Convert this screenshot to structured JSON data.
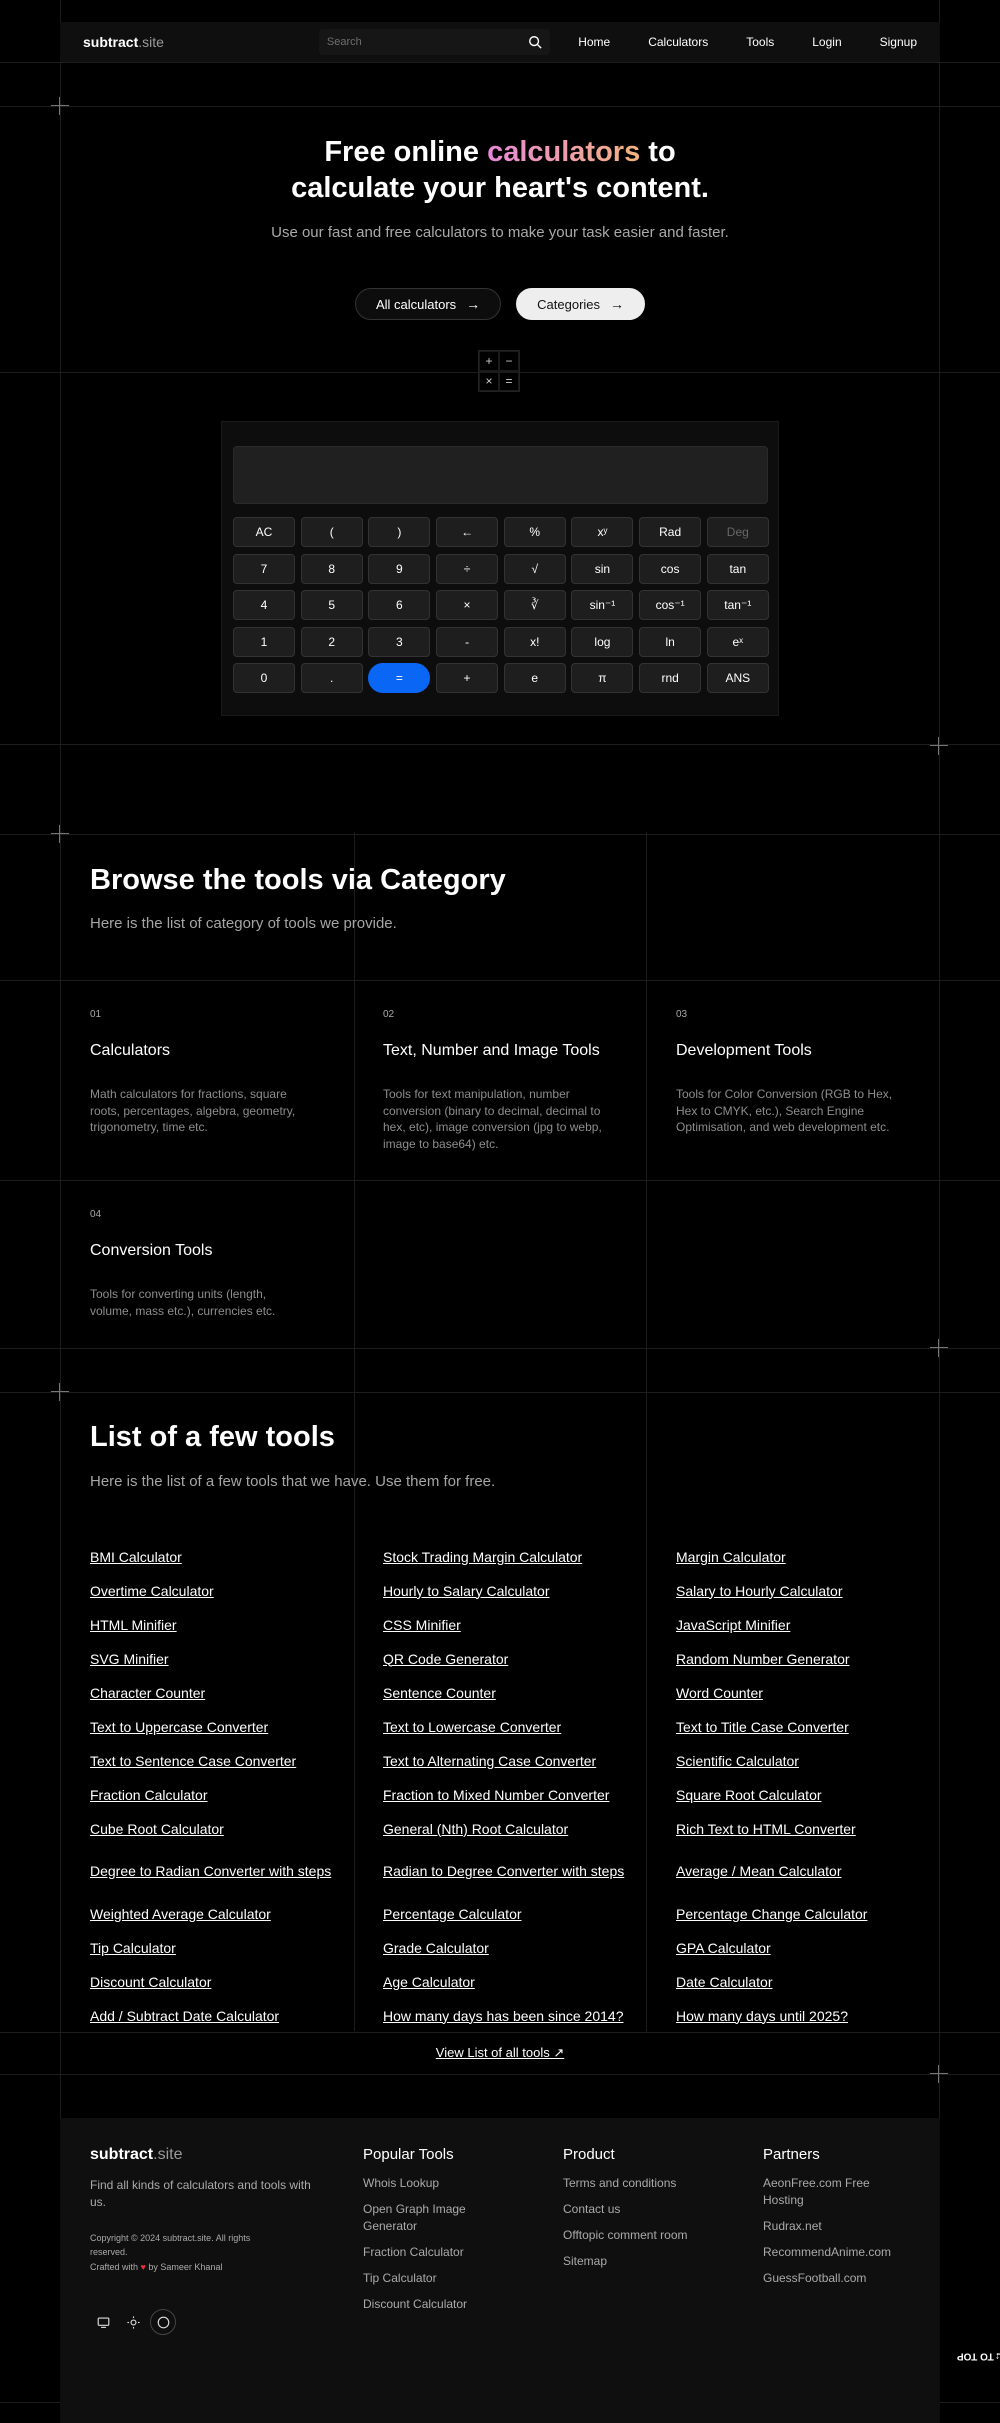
{
  "header": {
    "brand_main": "subtract",
    "brand_suffix": ".site",
    "search_placeholder": "Search",
    "nav": [
      "Home",
      "Calculators",
      "Tools",
      "Login",
      "Signup"
    ]
  },
  "hero": {
    "title_part1": "Free online",
    "title_highlight": "calculators",
    "title_part2": "to",
    "title_line2": "calculate your heart's content.",
    "subtitle": "Use our fast and free calculators to make your task easier and faster.",
    "btn_all": "All calculators",
    "btn_categories": "Categories"
  },
  "mini_grid": [
    "+",
    "−",
    "×",
    "="
  ],
  "calculator": {
    "keys": [
      "AC",
      "(",
      ")",
      "←",
      "%",
      "xʸ",
      "Rad",
      "Deg",
      "7",
      "8",
      "9",
      "÷",
      "√",
      "sin",
      "cos",
      "tan",
      "4",
      "5",
      "6",
      "×",
      "∛",
      "sin⁻¹",
      "cos⁻¹",
      "tan⁻¹",
      "1",
      "2",
      "3",
      "-",
      "x!",
      "log",
      "ln",
      "eˣ",
      "0",
      ".",
      "=",
      "+",
      "e",
      "π",
      "rnd",
      "ANS"
    ],
    "inactive_key": "Deg",
    "accent_key": "=",
    "accent_color": "#0a67f5"
  },
  "categories": {
    "title": "Browse the tools via Category",
    "subtitle": "Here is the list of category of tools we provide.",
    "items": [
      {
        "num": "01",
        "name": "Calculators",
        "desc": "Math calculators for fractions, square roots, percentages, algebra, geometry, trigonometry, time etc."
      },
      {
        "num": "02",
        "name": "Text, Number and Image Tools",
        "desc": "Tools for text manipulation, number conversion (binary to decimal, decimal to hex, etc), image conversion (jpg to webp, image to base64) etc."
      },
      {
        "num": "03",
        "name": "Development Tools",
        "desc": "Tools for Color Conversion (RGB to Hex, Hex to CMYK, etc.), Search Engine Optimisation, and web development etc."
      },
      {
        "num": "04",
        "name": "Conversion Tools",
        "desc": "Tools for converting units (length, volume, mass etc.), currencies etc."
      }
    ]
  },
  "tools": {
    "title": "List of a few tools",
    "subtitle": "Here is the list of a few tools that we have. Use them for free.",
    "items": [
      "BMI Calculator",
      "Stock Trading Margin Calculator",
      "Margin Calculator",
      "Overtime Calculator",
      "Hourly to Salary Calculator",
      "Salary to Hourly Calculator",
      "HTML Minifier",
      "CSS Minifier",
      "JavaScript Minifier",
      "SVG Minifier",
      "QR Code Generator",
      "Random Number Generator",
      "Character Counter",
      "Sentence Counter",
      "Word Counter",
      "Text to Uppercase Converter",
      "Text to Lowercase Converter",
      "Text to Title Case Converter",
      "Text to Sentence Case Converter",
      "Text to Alternating Case Converter",
      "Scientific Calculator",
      "Fraction Calculator",
      "Fraction to Mixed Number Converter",
      "Square Root Calculator",
      "Cube Root Calculator",
      "General (Nth) Root Calculator",
      "Rich Text to HTML Converter",
      "Degree to Radian Converter with steps",
      "Radian to Degree Converter with steps",
      "Average / Mean Calculator",
      "Weighted Average Calculator",
      "Percentage Calculator",
      "Percentage Change Calculator",
      "Tip Calculator",
      "Grade Calculator",
      "GPA Calculator",
      "Discount Calculator",
      "Age Calculator",
      "Date Calculator",
      "Add / Subtract Date Calculator",
      "How many days has been since 2014?",
      "How many days until 2025?"
    ],
    "view_all": "View List of all tools ↗"
  },
  "footer": {
    "brand_main": "subtract",
    "brand_suffix": ".site",
    "tagline": "Find all kinds of calculators and tools with us.",
    "copyright": "Copyright © 2024 subtract.site. All rights reserved.",
    "made_prefix": "Crafted with",
    "made_suffix": "by Sameer Khanal",
    "columns": [
      {
        "title": "Popular Tools",
        "links": [
          "Whois Lookup",
          "Open Graph Image Generator",
          "Fraction Calculator",
          "Tip Calculator",
          "Discount Calculator"
        ]
      },
      {
        "title": "Product",
        "links": [
          "Terms and conditions",
          "Contact us",
          "Offtopic comment room",
          "Sitemap"
        ]
      },
      {
        "title": "Partners",
        "links": [
          "AeonFree.com Free Hosting",
          "Rudrax.net",
          "RecommendAnime.com",
          "GuessFootball.com"
        ]
      }
    ],
    "scroll_top": "SCROLL TO TOP"
  }
}
